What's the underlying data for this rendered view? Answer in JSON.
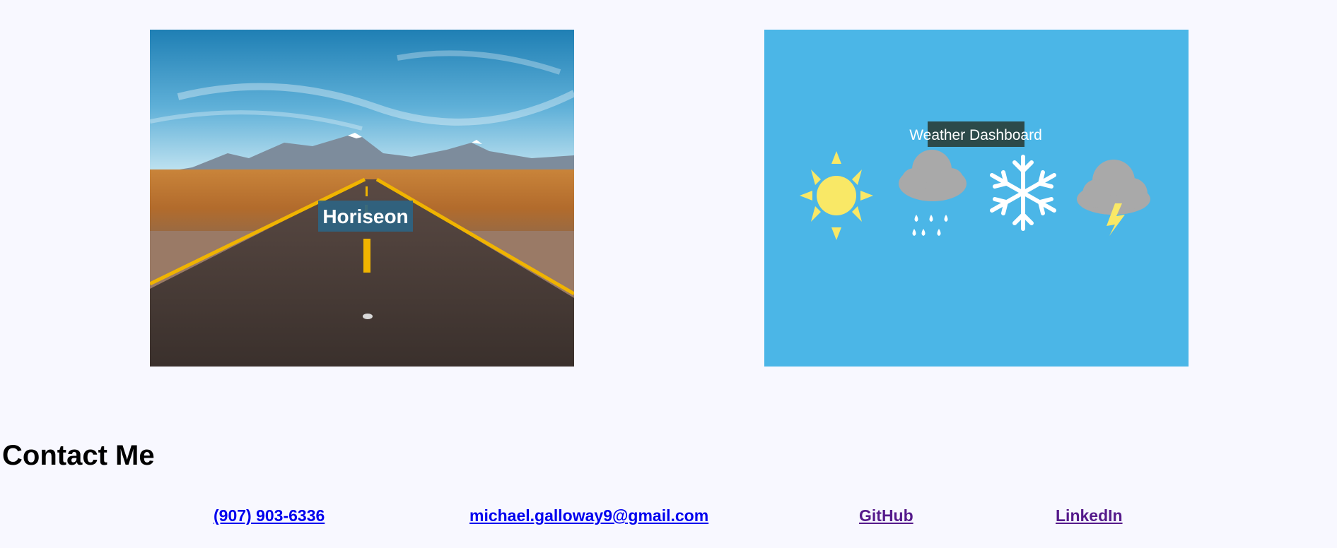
{
  "projects": [
    {
      "name": "Horiseon",
      "label": "Horiseon",
      "image_icon": "desert-road-image"
    },
    {
      "name": "Weather Dashboard",
      "label": "Weather Dashboard",
      "image_icon": "weather-icons-image"
    }
  ],
  "contact": {
    "heading": "Contact Me",
    "phone": "(907) 903-6336",
    "email": "michael.galloway9@gmail.com",
    "github": "GitHub",
    "linkedin": "LinkedIn"
  },
  "colors": {
    "page_background": "#f8f8ff",
    "link_unvisited": "#0000ee",
    "link_visited": "#551a8b",
    "weather_background": "#4bb6e7",
    "horiseon_label_bg": "#2e6482",
    "weather_label_bg": "#2c4a4a"
  }
}
